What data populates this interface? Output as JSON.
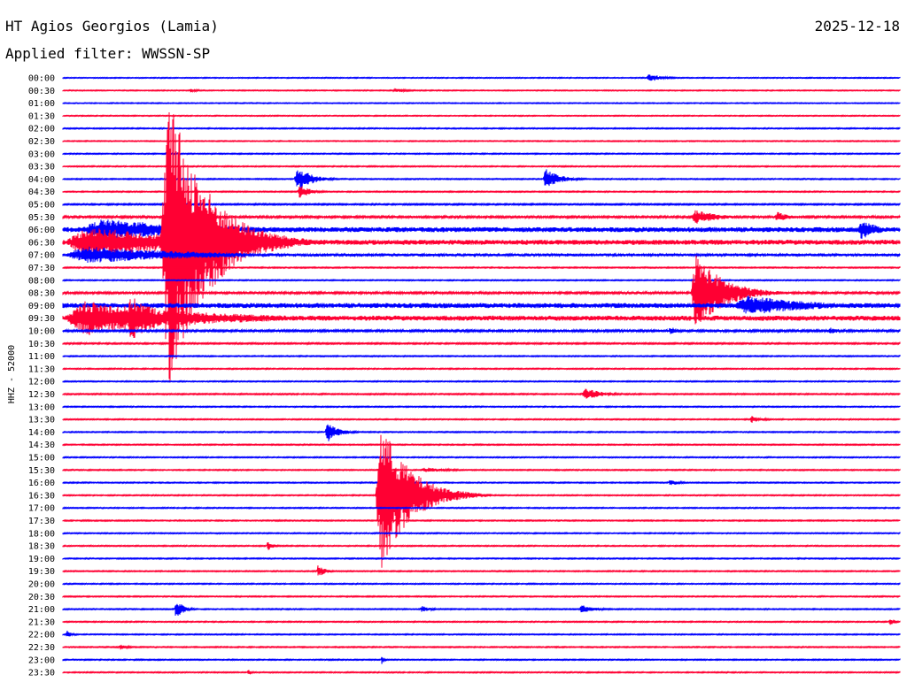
{
  "header": {
    "station": "HT Agios Georgios (Lamia)",
    "date": "2025-12-18",
    "filter": "Applied filter: WWSSN-SP"
  },
  "colors": {
    "odd": "#0000ff",
    "even": "#ff0033",
    "text": "#000000"
  },
  "chart_data": {
    "type": "line",
    "title": "HT Agios Georgios (Lamia)",
    "subtitle": "Applied filter: WWSSN-SP",
    "ylabel": "HHZ - 52000",
    "rows": [
      "00:00",
      "00:30",
      "01:00",
      "01:30",
      "02:00",
      "02:30",
      "03:00",
      "03:30",
      "04:00",
      "04:30",
      "05:00",
      "05:30",
      "06:00",
      "06:30",
      "07:00",
      "07:30",
      "08:00",
      "08:30",
      "09:00",
      "09:30",
      "10:00",
      "10:30",
      "11:00",
      "11:30",
      "12:00",
      "12:30",
      "13:00",
      "13:30",
      "14:00",
      "14:30",
      "15:00",
      "15:30",
      "16:00",
      "16:30",
      "17:00",
      "17:30",
      "18:00",
      "18:30",
      "19:00",
      "19:30",
      "20:00",
      "20:30",
      "21:00",
      "21:30",
      "22:00",
      "22:30",
      "23:00",
      "23:30"
    ],
    "row_minutes": 30,
    "series_colors": [
      "#0000ff",
      "#ff0033"
    ],
    "noise": [
      0.5,
      0.5,
      0.5,
      0.5,
      0.6,
      0.5,
      0.6,
      0.6,
      0.6,
      0.6,
      0.8,
      1.2,
      2.8,
      2.8,
      1.6,
      0.6,
      0.6,
      1.2,
      2.8,
      2.8,
      1.2,
      0.8,
      0.6,
      0.6,
      0.6,
      0.7,
      0.6,
      0.6,
      0.6,
      0.6,
      0.6,
      0.6,
      0.6,
      0.6,
      0.6,
      0.6,
      0.6,
      0.6,
      0.6,
      0.6,
      0.6,
      0.6,
      0.6,
      0.6,
      0.6,
      0.6,
      0.6,
      0.6
    ],
    "events": [
      {
        "row": 0,
        "minute": 20.9,
        "amp": 5,
        "dur": 1.2
      },
      {
        "row": 1,
        "minute": 11.8,
        "amp": 2,
        "dur": 1.5
      },
      {
        "row": 1,
        "minute": 4.5,
        "amp": 2,
        "dur": 0.8
      },
      {
        "row": 8,
        "minute": 8.3,
        "amp": 16,
        "dur": 1.2
      },
      {
        "row": 8,
        "minute": 17.2,
        "amp": 12,
        "dur": 1.3
      },
      {
        "row": 9,
        "minute": 8.4,
        "amp": 8,
        "dur": 1
      },
      {
        "row": 11,
        "minute": 22.5,
        "amp": 8,
        "dur": 2.2
      },
      {
        "row": 11,
        "minute": 25.5,
        "amp": 6,
        "dur": 1.2
      },
      {
        "row": 12,
        "minute": 0.5,
        "amp": 12,
        "dur": 11
      },
      {
        "row": 12,
        "minute": 28.5,
        "amp": 12,
        "dur": 1.5
      },
      {
        "row": 13,
        "minute": 0,
        "amp": 18,
        "dur": 11
      },
      {
        "row": 13,
        "minute": 3.5,
        "amp": 170,
        "dur": 3.5
      },
      {
        "row": 14,
        "minute": 0,
        "amp": 10,
        "dur": 10
      },
      {
        "row": 17,
        "minute": 22.5,
        "amp": 45,
        "dur": 2.5
      },
      {
        "row": 18,
        "minute": 24,
        "amp": 12,
        "dur": 6
      },
      {
        "row": 19,
        "minute": 0,
        "amp": 20,
        "dur": 10
      },
      {
        "row": 19,
        "minute": 2.2,
        "amp": 25,
        "dur": 3
      },
      {
        "row": 20,
        "minute": 21.7,
        "amp": 5,
        "dur": 0.8
      },
      {
        "row": 20,
        "minute": 27.4,
        "amp": 4,
        "dur": 1
      },
      {
        "row": 25,
        "minute": 18.6,
        "amp": 8,
        "dur": 1.4
      },
      {
        "row": 27,
        "minute": 24.6,
        "amp": 4,
        "dur": 1
      },
      {
        "row": 28,
        "minute": 9.4,
        "amp": 12,
        "dur": 1
      },
      {
        "row": 31,
        "minute": 12.8,
        "amp": 3,
        "dur": 2.2
      },
      {
        "row": 32,
        "minute": 21.7,
        "amp": 4,
        "dur": 0.8
      },
      {
        "row": 33,
        "minute": 11.2,
        "amp": 85,
        "dur": 2.6
      },
      {
        "row": 37,
        "minute": 7.3,
        "amp": 6,
        "dur": 0.5
      },
      {
        "row": 39,
        "minute": 9.1,
        "amp": 8,
        "dur": 0.6
      },
      {
        "row": 42,
        "minute": 4.0,
        "amp": 14,
        "dur": 0.6
      },
      {
        "row": 42,
        "minute": 12.8,
        "amp": 4,
        "dur": 0.8
      },
      {
        "row": 42,
        "minute": 18.5,
        "amp": 5,
        "dur": 1.2
      },
      {
        "row": 43,
        "minute": 29.6,
        "amp": 6,
        "dur": 0.4
      },
      {
        "row": 44,
        "minute": 0.1,
        "amp": 5,
        "dur": 0.5
      },
      {
        "row": 45,
        "minute": 2.0,
        "amp": 3,
        "dur": 0.8
      },
      {
        "row": 46,
        "minute": 11.4,
        "amp": 5,
        "dur": 0.3
      },
      {
        "row": 47,
        "minute": 6.6,
        "amp": 4,
        "dur": 0.3
      }
    ]
  }
}
